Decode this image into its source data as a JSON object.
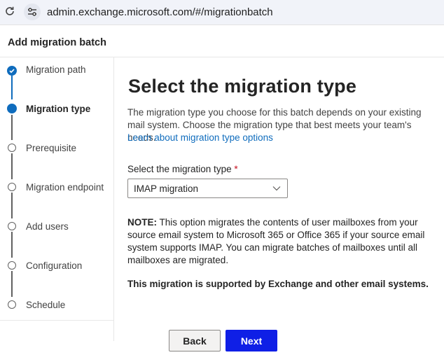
{
  "browser": {
    "url": "admin.exchange.microsoft.com/#/migrationbatch"
  },
  "panel": {
    "title": "Add migration batch"
  },
  "steps": [
    {
      "label": "Migration path",
      "state": "done"
    },
    {
      "label": "Migration type",
      "state": "current"
    },
    {
      "label": "Prerequisite",
      "state": "pending"
    },
    {
      "label": "Migration endpoint",
      "state": "pending"
    },
    {
      "label": "Add users",
      "state": "pending"
    },
    {
      "label": "Configuration",
      "state": "pending"
    },
    {
      "label": "Schedule",
      "state": "pending"
    }
  ],
  "main": {
    "title": "Select the migration type",
    "description": "The migration type you choose for this batch depends on your existing mail system. Choose the migration type that best meets your team's needs.",
    "learn_link": "Learn about migration type options",
    "select_label": "Select the migration type",
    "required_marker": "*",
    "select_value": "IMAP migration",
    "note_prefix": "NOTE:",
    "note_text": " This option migrates the contents of user mailboxes from your source email system to Microsoft 365 or Office 365 if your source email system supports IMAP. You can migrate batches of mailboxes until all mailboxes are migrated.",
    "support_text": "This migration is supported by Exchange and other email systems."
  },
  "footer": {
    "back_label": "Back",
    "next_label": "Next"
  },
  "colors": {
    "accent": "#0f6cbd",
    "primary_button": "#0f1fe6",
    "required": "#c50f1f"
  }
}
